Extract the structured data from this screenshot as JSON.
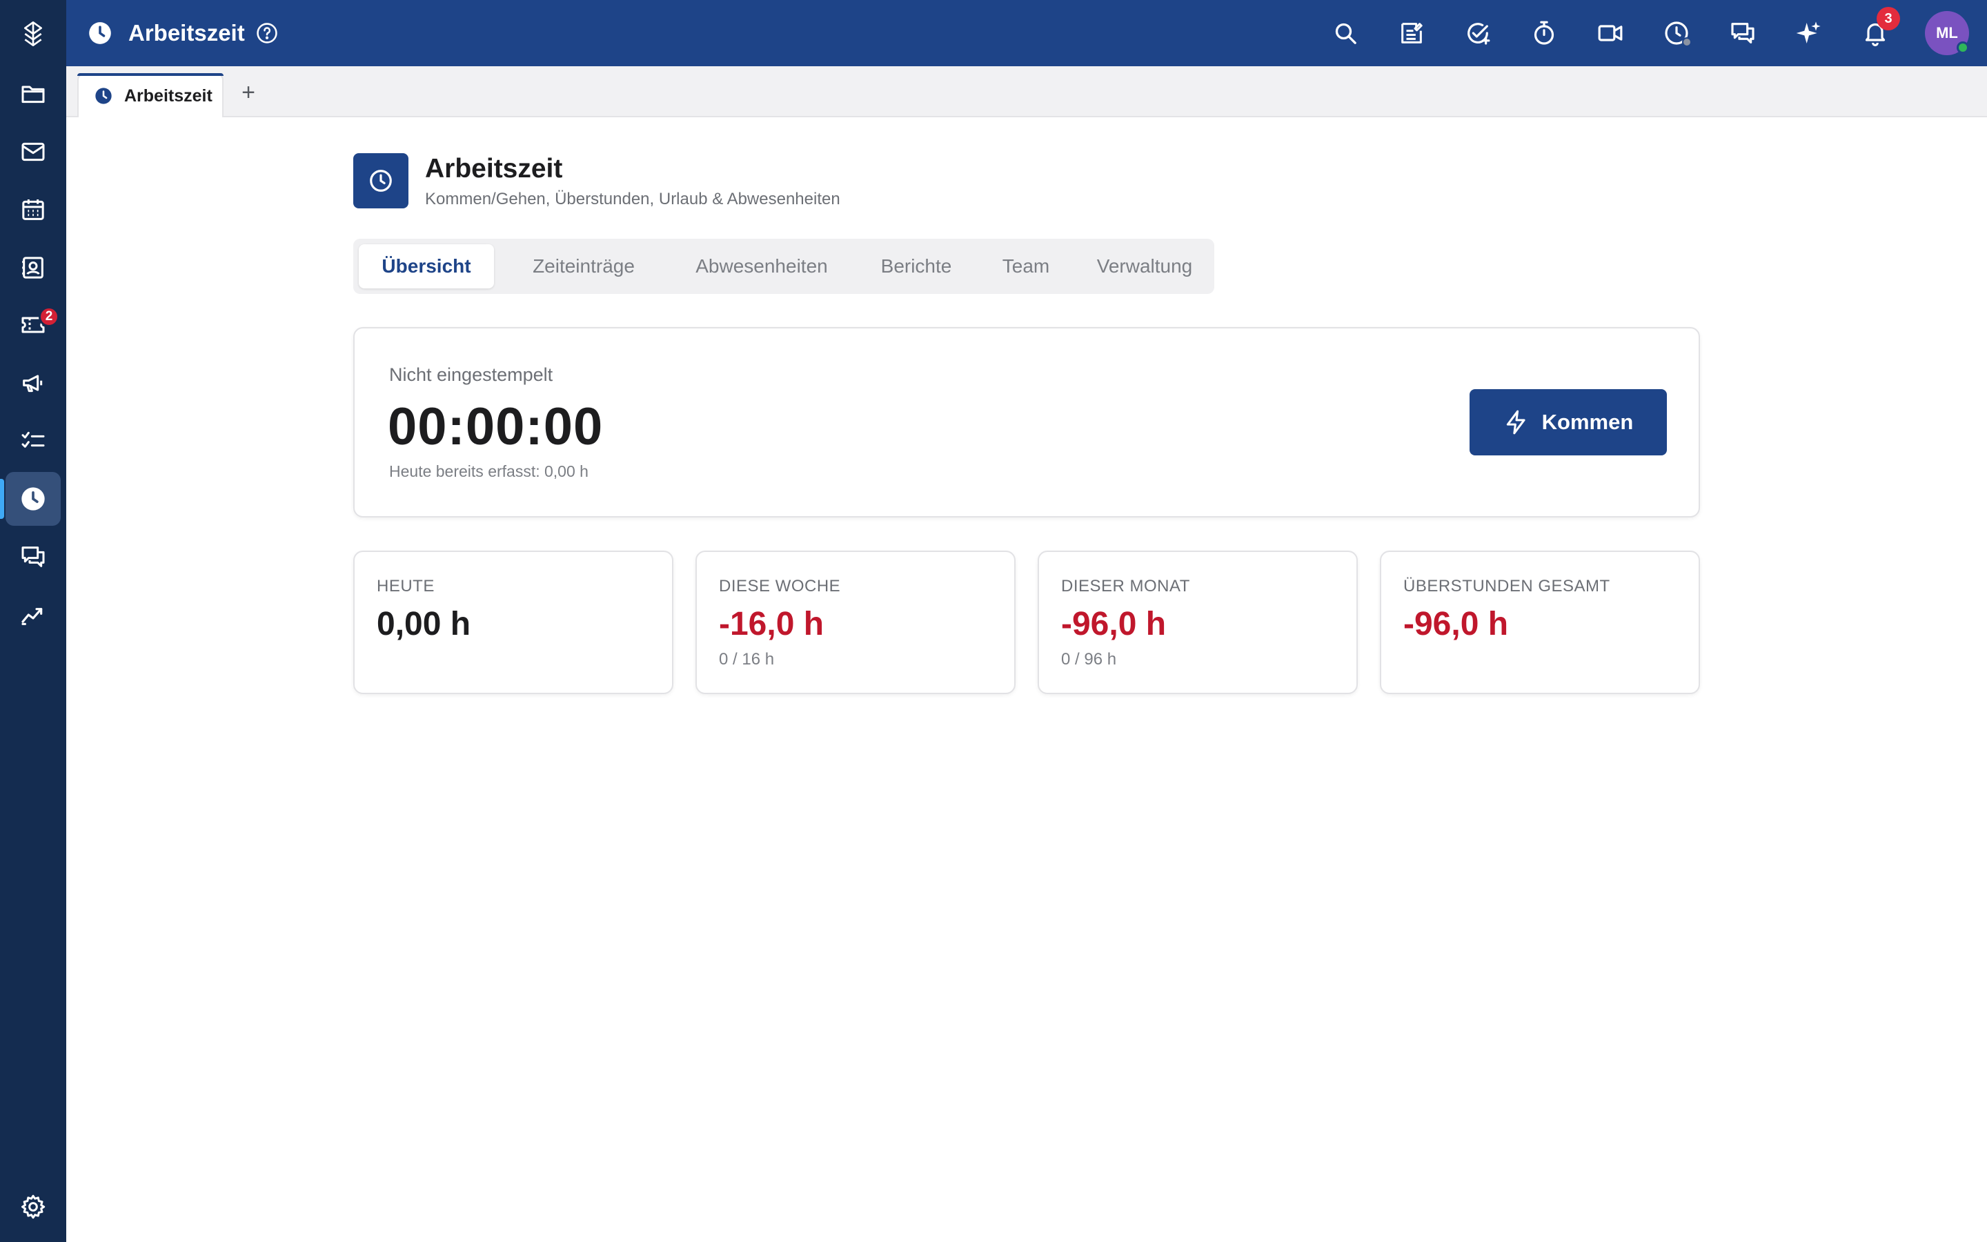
{
  "app": {
    "title": "Arbeitszeit",
    "accent_color": "#1e4488",
    "rail_color": "#142c50",
    "negative_color": "#c0172c"
  },
  "rail": {
    "items": [
      {
        "icon": "logo-icon"
      },
      {
        "icon": "folder-icon"
      },
      {
        "icon": "mail-icon"
      },
      {
        "icon": "calendar-icon"
      },
      {
        "icon": "contacts-icon"
      },
      {
        "icon": "tickets-icon",
        "badge": "2"
      },
      {
        "icon": "megaphone-icon"
      },
      {
        "icon": "checklist-icon"
      },
      {
        "icon": "clock-icon",
        "active": true
      },
      {
        "icon": "chat-icon"
      },
      {
        "icon": "analytics-icon"
      },
      {
        "icon": "settings-icon"
      }
    ]
  },
  "topbar": {
    "title": "Arbeitszeit",
    "icons": [
      "search-icon",
      "notes-icon",
      "task-check-icon",
      "stopwatch-icon",
      "video-icon",
      "time-status-icon",
      "messages-icon",
      "ai-sparkle-icon",
      "bell-icon"
    ],
    "notification_count": "3",
    "avatar_initials": "ML"
  },
  "tabs": {
    "open": [
      {
        "label": "Arbeitszeit"
      }
    ],
    "add_label": "+"
  },
  "page": {
    "title": "Arbeitszeit",
    "subtitle": "Kommen/Gehen, Überstunden, Urlaub & Abwesenheiten",
    "segments": [
      {
        "label": "Übersicht",
        "active": true
      },
      {
        "label": "Zeiteinträge"
      },
      {
        "label": "Abwesenheiten"
      },
      {
        "label": "Berichte"
      },
      {
        "label": "Team"
      },
      {
        "label": "Verwaltung"
      }
    ]
  },
  "clock": {
    "status": "Nicht eingestempelt",
    "timer": "00:00:00",
    "today_recorded": "Heute bereits erfasst: 0,00 h",
    "button_label": "Kommen"
  },
  "stats": [
    {
      "label": "HEUTE",
      "value": "0,00 h",
      "sub": "",
      "tone": "neutral"
    },
    {
      "label": "DIESE WOCHE",
      "value": "-16,0 h",
      "sub": "0 / 16 h",
      "tone": "negative"
    },
    {
      "label": "DIESER MONAT",
      "value": "-96,0 h",
      "sub": "0 / 96 h",
      "tone": "negative"
    },
    {
      "label": "ÜBERSTUNDEN GESAMT",
      "value": "-96,0 h",
      "sub": "",
      "tone": "negative"
    }
  ]
}
